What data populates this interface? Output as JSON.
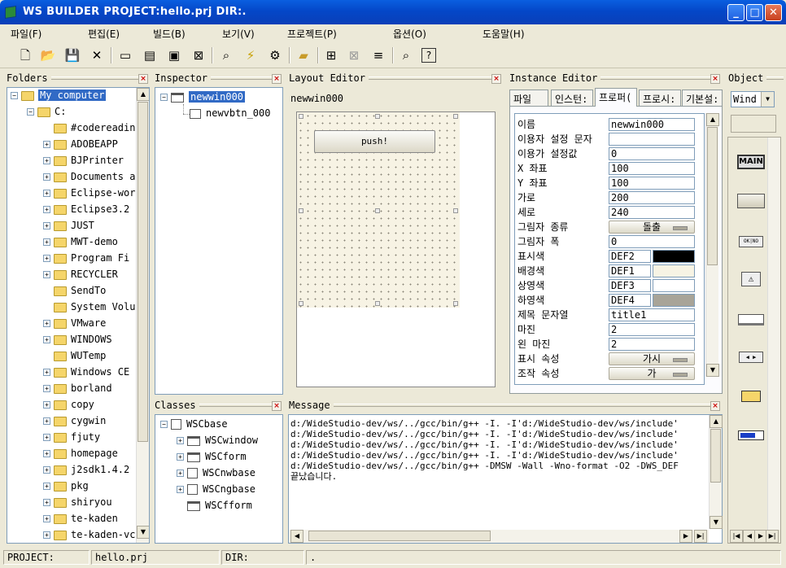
{
  "window": {
    "title": "WS BUILDER PROJECT:hello.prj DIR:."
  },
  "menu": [
    "파일(F)",
    "편집(E)",
    "빌드(B)",
    "보기(V)",
    "프로젝트(P)",
    "옵션(O)",
    "도움말(H)"
  ],
  "toolbar_icons": [
    "new-file-icon",
    "open-folder-icon",
    "save-icon",
    "cut-icon",
    "window-icon",
    "open-window-icon",
    "save-window-icon",
    "close-window-icon",
    "inspect-icon",
    "build-icon",
    "run-icon",
    "folder-icon",
    "grid-icon",
    "grid-off-icon",
    "align-icon",
    "preview-icon",
    "help-icon"
  ],
  "folders": {
    "title": "Folders",
    "items": [
      "My computer",
      "C:",
      "#codereadin",
      "ADOBEAPP",
      "BJPrinter",
      "Documents a",
      "Eclipse-wor",
      "Eclipse3.2",
      "JUST",
      "MWT-demo",
      "Program Fi",
      "RECYCLER",
      "SendTo",
      "System Volu",
      "VMware",
      "WINDOWS",
      "WUTemp",
      "Windows CE",
      "borland",
      "copy",
      "cygwin",
      "fjuty",
      "homepage",
      "j2sdk1.4.2",
      "pkg",
      "shiryou",
      "te-kaden",
      "te-kaden-vc"
    ]
  },
  "inspector": {
    "title": "Inspector",
    "items": [
      "newwin000",
      "newvbtn_000"
    ]
  },
  "layout_editor": {
    "title": "Layout Editor",
    "window_name": "newwin000",
    "button_label": "push!"
  },
  "instance_editor": {
    "title": "Instance Editor",
    "tabs": [
      "파일",
      "인스턴:",
      "프로퍼(",
      "프로시:",
      "기본설:"
    ],
    "props": [
      {
        "label": "이름",
        "value": "newwin000",
        "kind": "text"
      },
      {
        "label": "이용자 설정 문자",
        "value": "",
        "kind": "text"
      },
      {
        "label": "이용가 설정값",
        "value": "0",
        "kind": "text"
      },
      {
        "label": "X 좌표",
        "value": "100",
        "kind": "text"
      },
      {
        "label": "Y 좌표",
        "value": "100",
        "kind": "text"
      },
      {
        "label": "가로",
        "value": "200",
        "kind": "text"
      },
      {
        "label": "세로",
        "value": "240",
        "kind": "text"
      },
      {
        "label": "그림자 종류",
        "value": "돌출",
        "kind": "button"
      },
      {
        "label": "그림자 폭",
        "value": "0",
        "kind": "text"
      },
      {
        "label": "표시색",
        "value": "DEF2",
        "kind": "color",
        "swatch": "#000000"
      },
      {
        "label": "배경색",
        "value": "DEF1",
        "kind": "color",
        "swatch": "#f7f3e4"
      },
      {
        "label": "상영색",
        "value": "DEF3",
        "kind": "color",
        "swatch": "#ffffff"
      },
      {
        "label": "하영색",
        "value": "DEF4",
        "kind": "color",
        "swatch": "#a8a498"
      },
      {
        "label": "제목 문자열",
        "value": "title1",
        "kind": "text"
      },
      {
        "label": "마진",
        "value": "2",
        "kind": "text"
      },
      {
        "label": "왼 마진",
        "value": "2",
        "kind": "text"
      },
      {
        "label": "표시 속성",
        "value": "가시",
        "kind": "button"
      },
      {
        "label": "조작 속성",
        "value": "가",
        "kind": "button"
      }
    ]
  },
  "object_panel": {
    "title": "Object",
    "select_value": "Wind",
    "main_label": "MAIN"
  },
  "classes": {
    "title": "Classes",
    "items": [
      "WSCbase",
      "WSCwindow",
      "WSCform",
      "WSCnwbase",
      "WSCngbase",
      "WSCfform"
    ]
  },
  "message": {
    "title": "Message",
    "lines": [
      "d:/WideStudio-dev/ws/../gcc/bin/g++ -I. -I'd:/WideStudio-dev/ws/include'",
      "d:/WideStudio-dev/ws/../gcc/bin/g++ -I. -I'd:/WideStudio-dev/ws/include'",
      "d:/WideStudio-dev/ws/../gcc/bin/g++ -I. -I'd:/WideStudio-dev/ws/include'",
      "d:/WideStudio-dev/ws/../gcc/bin/g++ -I. -I'd:/WideStudio-dev/ws/include'",
      "d:/WideStudio-dev/ws/../gcc/bin/g++ -DMSW -Wall -Wno-format -O2  -DWS_DEF",
      "끝났습니다."
    ]
  },
  "status": {
    "project_label": "PROJECT:",
    "project_value": "hello.prj",
    "dir_label": "DIR:",
    "dir_value": "."
  }
}
